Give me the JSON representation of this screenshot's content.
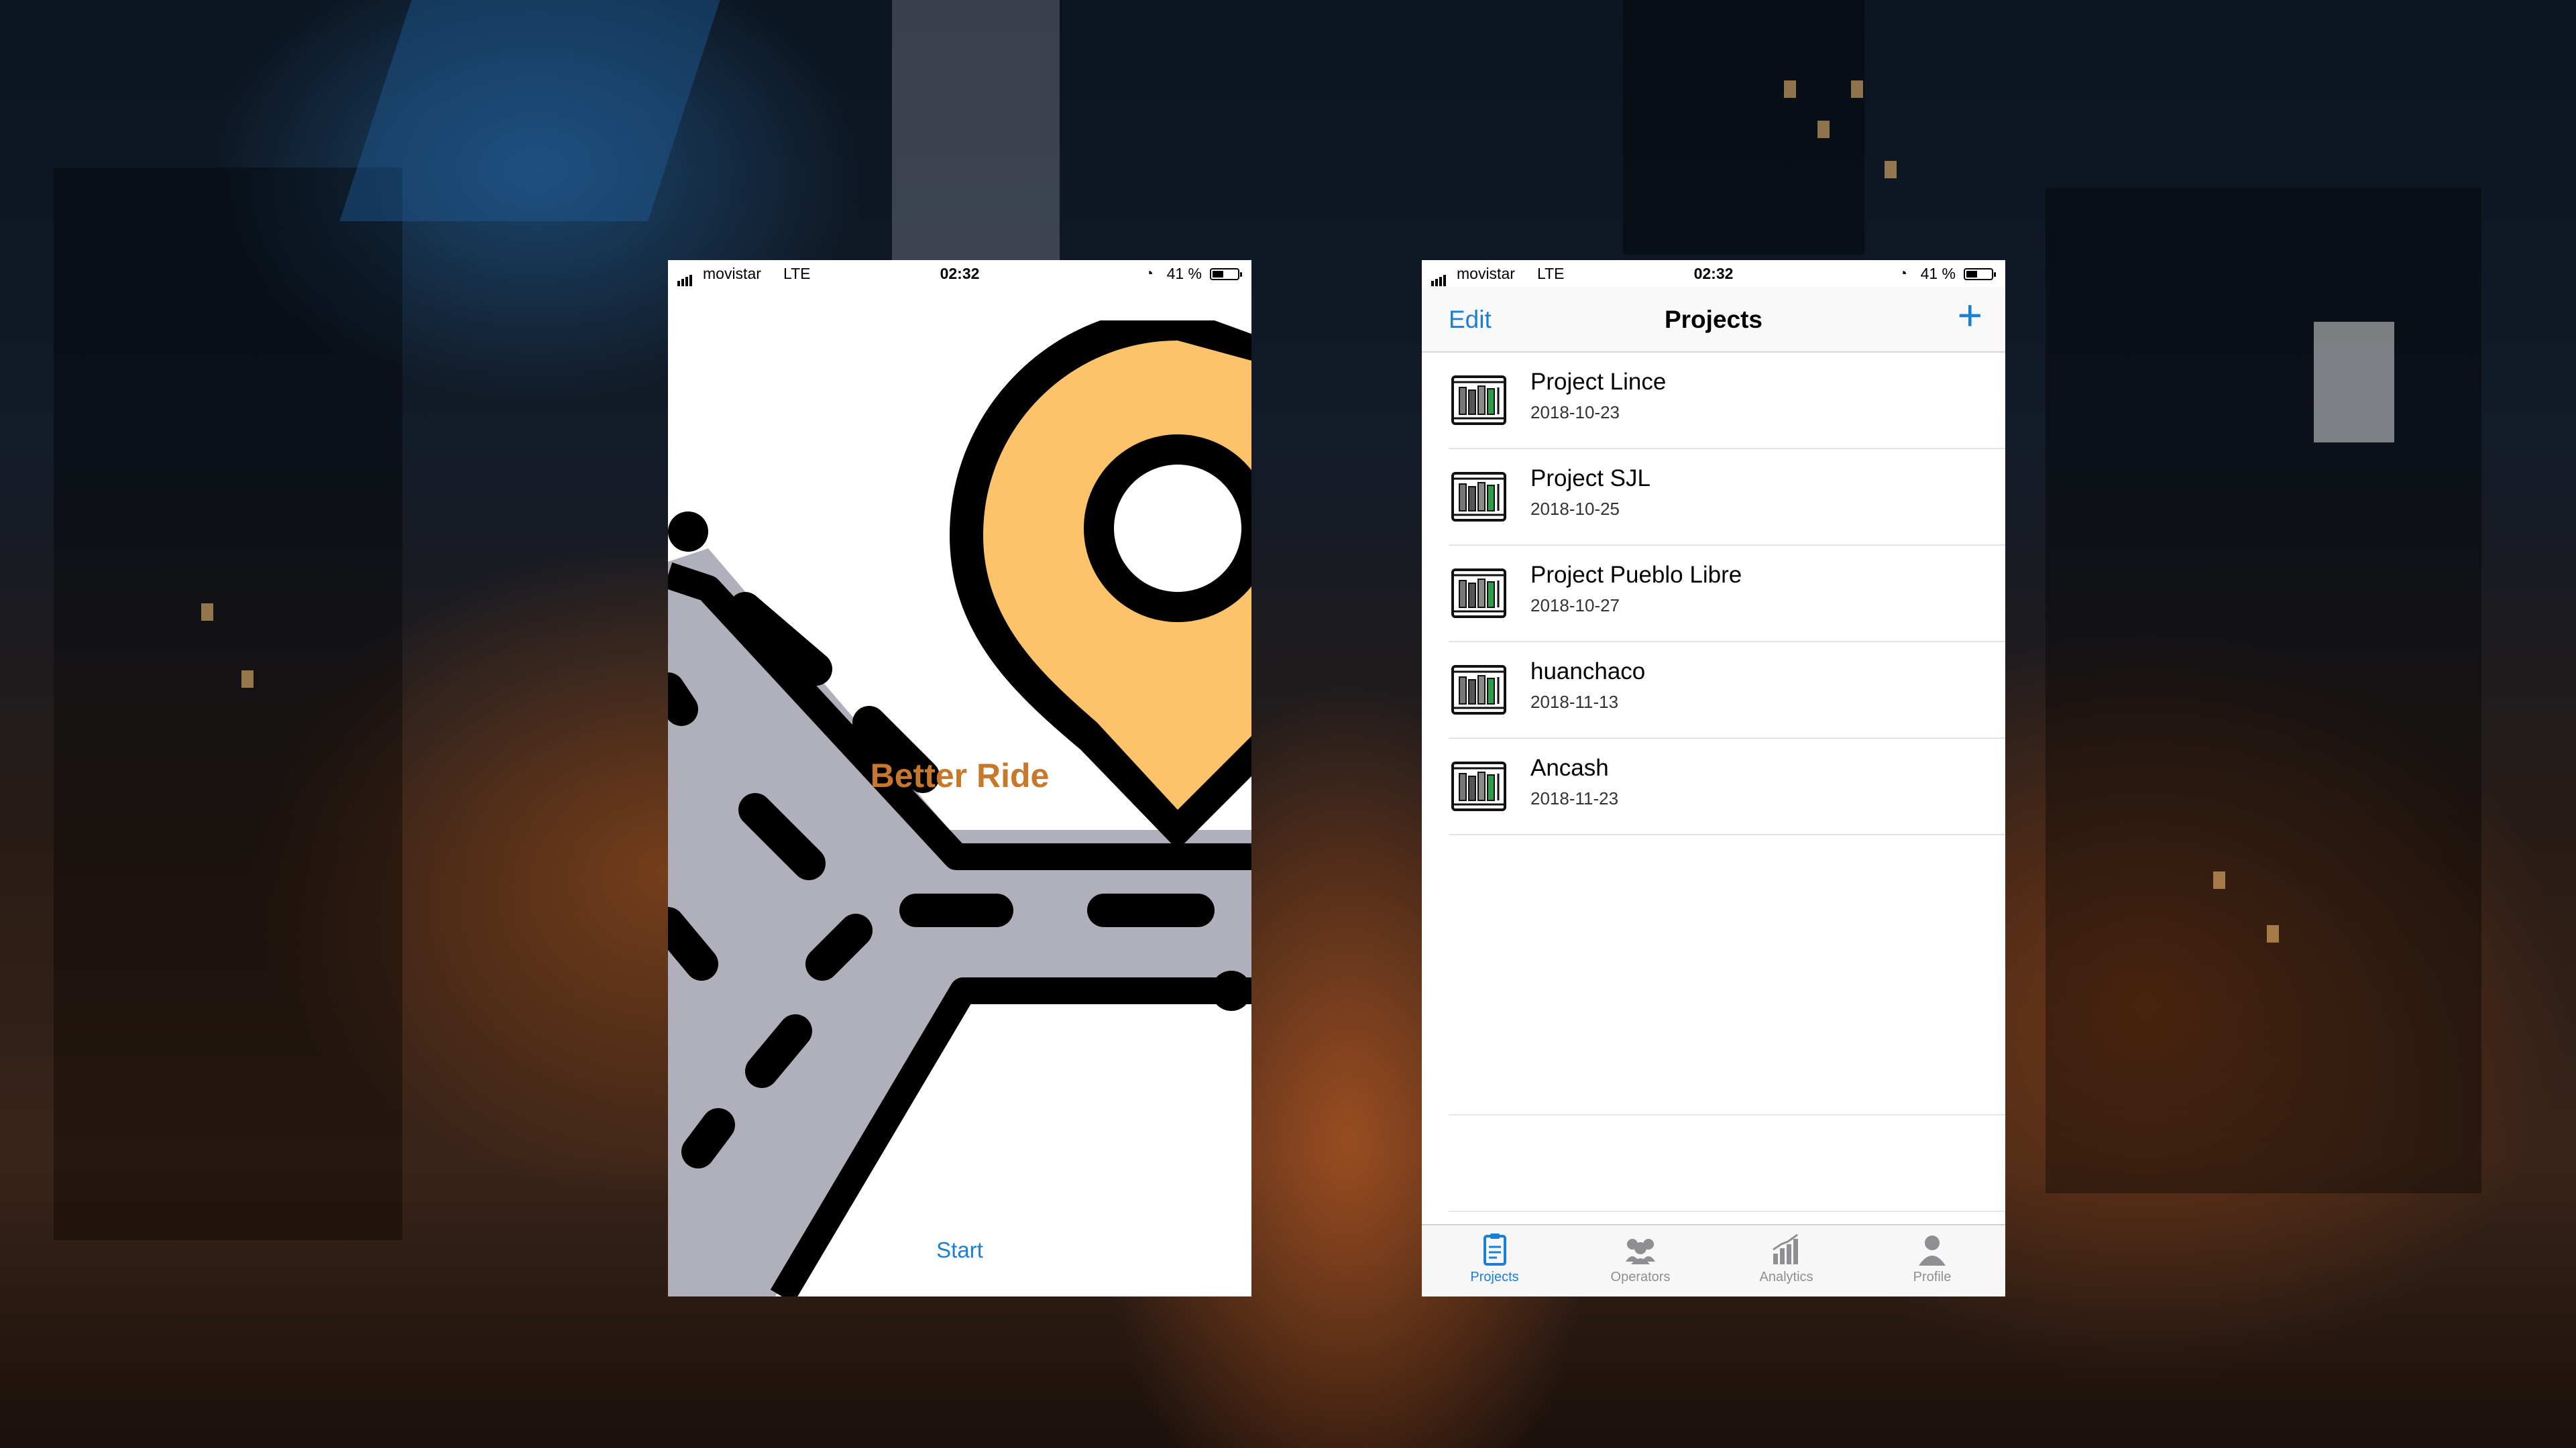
{
  "splash": {
    "status": {
      "carrier": "movistar",
      "network": "LTE",
      "time": "02:32",
      "battery_text": "41 %",
      "battery_level": 0.41
    },
    "title": "Better Ride",
    "start_label": "Start",
    "colors": {
      "title": "#c8782a",
      "link": "#1a7fd6",
      "pin": "#fdc36a",
      "road": "#b0b0bc"
    }
  },
  "projects_screen": {
    "status": {
      "carrier": "movistar",
      "network": "LTE",
      "time": "02:32",
      "battery_text": "41 %",
      "battery_level": 0.41
    },
    "nav": {
      "edit_label": "Edit",
      "title": "Projects",
      "add_icon": "plus-icon",
      "add_glyph": "+"
    },
    "projects": [
      {
        "name": "Project Lince",
        "date": "2018-10-23",
        "icon": "project-book-icon"
      },
      {
        "name": "Project SJL",
        "date": "2018-10-25",
        "icon": "project-book-icon"
      },
      {
        "name": "Project Pueblo Libre",
        "date": "2018-10-27",
        "icon": "project-book-icon"
      },
      {
        "name": "huanchaco",
        "date": "2018-11-13",
        "icon": "project-book-icon"
      },
      {
        "name": "Ancash",
        "date": "2018-11-23",
        "icon": "project-book-icon"
      }
    ],
    "tabs": [
      {
        "label": "Projects",
        "icon": "clipboard-icon",
        "active": true
      },
      {
        "label": "Operators",
        "icon": "users-icon",
        "active": false
      },
      {
        "label": "Analytics",
        "icon": "bar-chart-icon",
        "active": false
      },
      {
        "label": "Profile",
        "icon": "person-icon",
        "active": false
      }
    ],
    "colors": {
      "accent": "#1a7fd6",
      "inactive_tab": "#8e8e93"
    }
  }
}
